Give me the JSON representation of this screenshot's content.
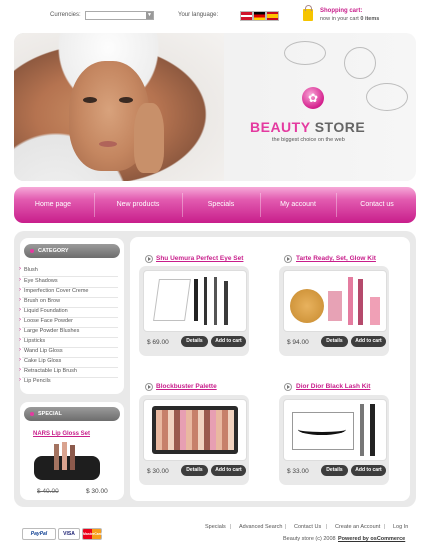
{
  "topbar": {
    "currencies_label": "Currencies:",
    "currencies_value": "",
    "language_label": "Your language:",
    "languages": [
      "English",
      "Deutsch",
      "Español"
    ],
    "cart_title": "Shopping cart:",
    "cart_text_prefix": "now in your cart ",
    "cart_count": "0 items"
  },
  "header": {
    "brand_part1": "BEAUTY",
    "brand_part2": "STORE",
    "tagline": "the biggest choice on the web"
  },
  "nav": {
    "items": [
      "Home page",
      "New products",
      "Specials",
      "My account",
      "Contact us"
    ]
  },
  "sidebar": {
    "category_title": "CATEGORY",
    "categories": [
      "Blush",
      "Eye Shadows",
      "Imperfection Cover Creme",
      "Brush on Brow",
      "Liquid Foundation",
      "Loose Face Powder",
      "Large Powder Blushes",
      "Lipsticks",
      "Wand Lip Gloss",
      "Cake Lip Gloss",
      "Retractable Lip Brush",
      "Lip Pencils"
    ],
    "special_title": "SPECIAL",
    "special_product": "NARS Lip Gloss Set",
    "special_old_price": "$ 40.00",
    "special_new_price": "$ 30.00"
  },
  "products": [
    {
      "title": "Shu Uemura Perfect Eye Set",
      "price": "$ 69.00",
      "details": "Details",
      "add": "Add to cart"
    },
    {
      "title": "Tarte Ready, Set, Glow Kit",
      "price": "$ 94.00",
      "details": "Details",
      "add": "Add to cart"
    },
    {
      "title": "Blockbuster Palette",
      "price": "$ 30.00",
      "details": "Details",
      "add": "Add to cart"
    },
    {
      "title": "Dior Dior Black Lash Kit",
      "price": "$ 33.00",
      "details": "Details",
      "add": "Add to cart"
    }
  ],
  "footer": {
    "links": [
      "Specials",
      "Advanced Search",
      "Contact Us",
      "Create an Account",
      "Log In"
    ],
    "separator": "|",
    "copyright": "Beauty store (c) 2008",
    "powered": "Powered by osCommerce",
    "payment": [
      "PayPal",
      "VISA",
      "MasterCard"
    ]
  },
  "colors": {
    "accent": "#c81e8b",
    "accent_light": "#e43aa0",
    "dark_button": "#3d3d3d"
  }
}
